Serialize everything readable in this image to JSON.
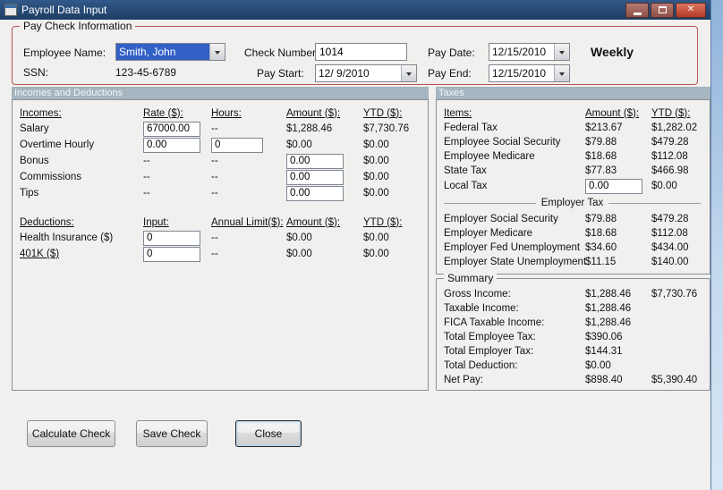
{
  "window": {
    "title": "Payroll Data Input"
  },
  "icons": {
    "close_glyph": "✕"
  },
  "paycheck": {
    "group_title": "Pay Check Information",
    "employee_name": {
      "label": "Employee Name:",
      "value": "Smith, John"
    },
    "ssn": {
      "label": "SSN:",
      "value": "123-45-6789"
    },
    "check_number": {
      "label": "Check Number:",
      "value": "1014"
    },
    "pay_start": {
      "label": "Pay Start:",
      "value": "12/ 9/2010"
    },
    "pay_date": {
      "label": "Pay Date:",
      "value": "12/15/2010"
    },
    "pay_end": {
      "label": "Pay End:",
      "value": "12/15/2010"
    },
    "frequency": "Weekly"
  },
  "section_headers": {
    "incomes_deductions": "Incomes and Deductions",
    "taxes": "Taxes"
  },
  "incomes": {
    "headers": {
      "name": "Incomes:",
      "rate": "Rate ($):",
      "hours": "Hours:",
      "amount": "Amount ($):",
      "ytd": "YTD ($):"
    },
    "rows": [
      {
        "label": "Salary",
        "rate": "67000.00",
        "hours": "--",
        "amount": "$1,288.46",
        "ytd": "$7,730.76"
      },
      {
        "label": "Overtime Hourly",
        "rate": "0.00",
        "hours": "0",
        "amount": "$0.00",
        "ytd": "$0.00"
      },
      {
        "label": "Bonus",
        "rate": "--",
        "hours": "--",
        "amount": "0.00",
        "ytd": "$0.00"
      },
      {
        "label": "Commissions",
        "rate": "--",
        "hours": "--",
        "amount": "0.00",
        "ytd": "$0.00"
      },
      {
        "label": "Tips",
        "rate": "--",
        "hours": "--",
        "amount": "0.00",
        "ytd": "$0.00"
      }
    ]
  },
  "deductions": {
    "headers": {
      "name": "Deductions:",
      "input": "Input:",
      "annual_limit": "Annual Limit($):",
      "amount": "Amount ($):",
      "ytd": "YTD ($):"
    },
    "rows": [
      {
        "label": "Health Insurance ($)",
        "input": "0",
        "annual_limit": "--",
        "amount": "$0.00",
        "ytd": "$0.00"
      },
      {
        "label": "401K ($)",
        "input": "0",
        "annual_limit": "--",
        "amount": "$0.00",
        "ytd": "$0.00"
      }
    ]
  },
  "taxes": {
    "headers": {
      "items": "Items:",
      "amount": "Amount ($):",
      "ytd": "YTD ($):"
    },
    "employee_rows": [
      {
        "label": "Federal Tax",
        "amount": "$213.67",
        "ytd": "$1,282.02"
      },
      {
        "label": "Employee Social Security",
        "amount": "$79.88",
        "ytd": "$479.28"
      },
      {
        "label": "Employee Medicare",
        "amount": "$18.68",
        "ytd": "$112.08"
      },
      {
        "label": "State Tax",
        "amount": "$77.83",
        "ytd": "$466.98"
      },
      {
        "label": "Local Tax",
        "amount": "0.00",
        "ytd": "$0.00"
      }
    ],
    "employer_header": "Employer Tax",
    "employer_rows": [
      {
        "label": "Employer Social Security",
        "amount": "$79.88",
        "ytd": "$479.28"
      },
      {
        "label": "Employer Medicare",
        "amount": "$18.68",
        "ytd": "$112.08"
      },
      {
        "label": "Employer Fed Unemployment",
        "amount": "$34.60",
        "ytd": "$434.00"
      },
      {
        "label": "Employer State Unemployment",
        "amount": "$11.15",
        "ytd": "$140.00"
      }
    ]
  },
  "summary": {
    "group_title": "Summary",
    "rows": [
      {
        "label": "Gross Income:",
        "amount": "$1,288.46",
        "ytd": "$7,730.76"
      },
      {
        "label": "Taxable Income:",
        "amount": "$1,288.46",
        "ytd": ""
      },
      {
        "label": "FICA Taxable Income:",
        "amount": "$1,288.46",
        "ytd": ""
      },
      {
        "label": "Total Employee Tax:",
        "amount": "$390.06",
        "ytd": ""
      },
      {
        "label": "Total Employer Tax:",
        "amount": "$144.31",
        "ytd": ""
      },
      {
        "label": "Total Deduction:",
        "amount": "$0.00",
        "ytd": ""
      },
      {
        "label": "Net Pay:",
        "amount": "$898.40",
        "ytd": "$5,390.40"
      }
    ]
  },
  "buttons": {
    "calculate": "Calculate Check",
    "save": "Save Check",
    "close": "Close"
  }
}
